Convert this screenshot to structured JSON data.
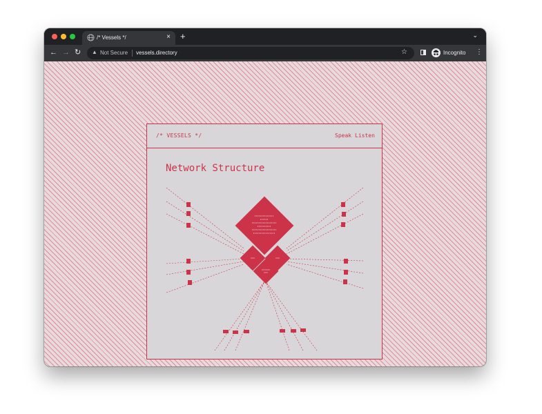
{
  "browser": {
    "tab_title": "/* Vessels */",
    "tab_close": "×",
    "new_tab": "+",
    "tab_menu": "⌄",
    "nav_back": "←",
    "nav_forward": "→",
    "nav_reload": "↻",
    "security_label": "Not Secure",
    "url": "vessels.directory",
    "bookmark": "☆",
    "profile_label": "Incognito",
    "menu": "⋮"
  },
  "page": {
    "brand": "/* VESSELS */",
    "nav": [
      "Speak",
      "Listen"
    ],
    "section_title": "Network Structure"
  },
  "colors": {
    "accent": "#cc3349",
    "card_bg": "#d8d6d8",
    "pattern_bg": "#e8d9dc"
  }
}
